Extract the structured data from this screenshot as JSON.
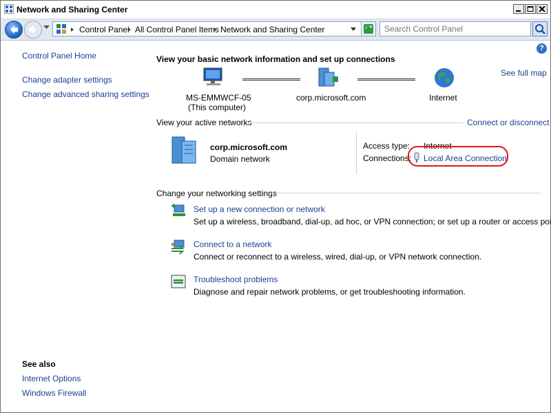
{
  "window": {
    "title": "Network and Sharing Center"
  },
  "navbar": {
    "breadcrumbs": [
      "Control Panel",
      "All Control Panel Items",
      "Network and Sharing Center"
    ],
    "search_placeholder": "Search Control Panel"
  },
  "sidebar": {
    "home": "Control Panel Home",
    "links": [
      "Change adapter settings",
      "Change advanced sharing settings"
    ],
    "see_also_title": "See also",
    "see_also": [
      "Internet Options",
      "Windows Firewall"
    ]
  },
  "main": {
    "heading": "View your basic network information and set up connections",
    "see_full_map": "See full map",
    "map": {
      "computer_name": "MS-EMMWCF-05",
      "computer_note": "(This computer)",
      "domain": "corp.microsoft.com",
      "internet": "Internet"
    },
    "active_networks": {
      "title": "View your active networks",
      "connect_link": "Connect or disconnect",
      "network_name": "corp.microsoft.com",
      "network_type": "Domain network",
      "access_type_label": "Access type:",
      "access_type_value": "Internet",
      "connections_label": "Connections:",
      "connection_value": "Local Area Connection"
    },
    "settings": {
      "title": "Change your networking settings",
      "items": [
        {
          "title": "Set up a new connection or network",
          "desc": "Set up a wireless, broadband, dial-up, ad hoc, or VPN connection; or set up a router or access point."
        },
        {
          "title": "Connect to a network",
          "desc": "Connect or reconnect to a wireless, wired, dial-up, or VPN network connection."
        },
        {
          "title": "Troubleshoot problems",
          "desc": "Diagnose and repair network problems, or get troubleshooting information."
        }
      ]
    }
  },
  "colors": {
    "link": "#1a3f8f",
    "annotation": "#e0141e"
  }
}
